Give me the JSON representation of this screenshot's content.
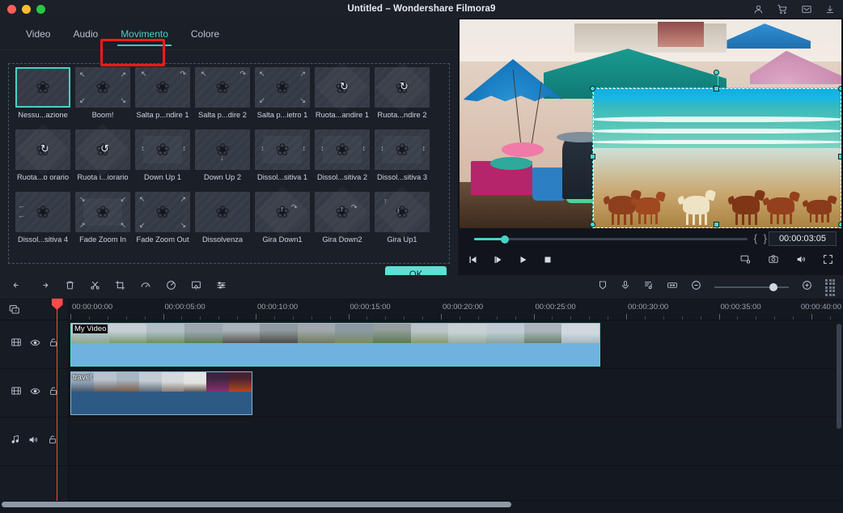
{
  "window": {
    "title": "Untitled – Wondershare Filmora9",
    "traffic_lights": [
      "close",
      "minimize",
      "maximize"
    ],
    "right_icons": [
      "account-icon",
      "cart-icon",
      "inbox-icon",
      "download-icon"
    ]
  },
  "tabs": [
    {
      "label": "Video",
      "active": false
    },
    {
      "label": "Audio",
      "active": false
    },
    {
      "label": "Movimento",
      "active": true
    },
    {
      "label": "Colore",
      "active": false
    }
  ],
  "annotation": {
    "color": "#f61a1a",
    "target": "Movimento"
  },
  "effects": {
    "selected_index": 0,
    "items": [
      {
        "label": "Nessu...azione",
        "icon": "none"
      },
      {
        "label": "Boom!",
        "icon": "corners-out"
      },
      {
        "label": "Salta p...ndire 1",
        "icon": "top-arrows"
      },
      {
        "label": "Salta p...dire 2",
        "icon": "top-arrows"
      },
      {
        "label": "Salta p...ietro 1",
        "icon": "diag-arrows"
      },
      {
        "label": "Ruota...andire 1",
        "icon": "rotate-cw"
      },
      {
        "label": "Ruota...ndire 2",
        "icon": "rotate-cw"
      },
      {
        "label": "Ruota...o orario",
        "icon": "rotate-cw"
      },
      {
        "label": "Ruota i...iorario",
        "icon": "rotate-ccw"
      },
      {
        "label": "Down Up 1",
        "icon": "updown-arrows"
      },
      {
        "label": "Down Up 2",
        "icon": "down-arrow"
      },
      {
        "label": "Dissol...sitiva 1",
        "icon": "updown-arrows"
      },
      {
        "label": "Dissol...sitiva 2",
        "icon": "updown-arrows"
      },
      {
        "label": "Dissol...sitiva 3",
        "icon": "updown-arrows"
      },
      {
        "label": "Dissol...sitiva 4",
        "icon": "left-arrows"
      },
      {
        "label": "Fade Zoom In",
        "icon": "corners-in"
      },
      {
        "label": "Fade Zoom Out",
        "icon": "corners-out"
      },
      {
        "label": "Dissolvenza",
        "icon": "plain"
      },
      {
        "label": "Gira Down1",
        "icon": "flip-down"
      },
      {
        "label": "Gira Down2",
        "icon": "flip-down"
      },
      {
        "label": "Gira Up1",
        "icon": "flip-up"
      }
    ]
  },
  "ok_button": {
    "label": "OK",
    "color": "#5fe0d2"
  },
  "player": {
    "timecode": "00:00:03:05",
    "mark_in": "{",
    "mark_out": "}",
    "progress_percent": 11,
    "buttons": [
      "prev-frame-button",
      "next-frame-button",
      "play-button",
      "stop-button"
    ],
    "right_buttons": [
      "screen-settings-icon",
      "snapshot-icon",
      "volume-icon",
      "fullscreen-icon"
    ]
  },
  "toolbar": {
    "left_icons": [
      "undo-icon",
      "redo-icon",
      "delete-icon",
      "split-icon",
      "crop-icon",
      "speed-icon",
      "color-icon",
      "green-screen-icon",
      "audio-mixer-icon"
    ],
    "right_icons": [
      "marker-icon",
      "voiceover-icon",
      "audio-detach-icon",
      "fit-timeline-icon"
    ],
    "zoom": {
      "out_label": "zoom-out-icon",
      "in_label": "zoom-in-icon",
      "value_percent": 74
    }
  },
  "timeline": {
    "ruler_labels": [
      "00:00:00:00",
      "00:00:05:00",
      "00:00:10:00",
      "00:00:15:00",
      "00:00:20:00",
      "00:00:25:00",
      "00:00:30:00",
      "00:00:35:00",
      "00:00:40:00"
    ],
    "playhead_position": "00:00:03:05",
    "tracks": [
      {
        "type": "video",
        "icons": [
          "film-icon",
          "eye-icon",
          "unlock-icon"
        ],
        "clip": {
          "name": "My Video",
          "selected": true,
          "color": "#6fb2e0"
        }
      },
      {
        "type": "video",
        "icons": [
          "film-icon",
          "eye-icon",
          "unlock-icon"
        ],
        "clip": {
          "name": "travel",
          "selected": false,
          "color": "#2d5a85"
        }
      },
      {
        "type": "audio",
        "icons": [
          "music-icon",
          "speaker-icon",
          "unlock-icon"
        ],
        "clip": null
      }
    ],
    "add_track_icon": "add-media-icon"
  }
}
